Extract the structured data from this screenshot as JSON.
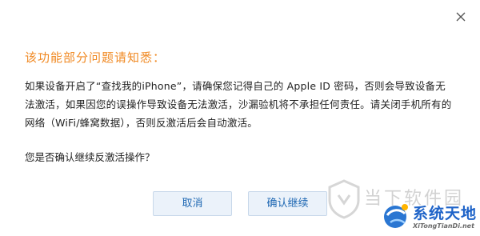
{
  "dialog": {
    "title": "该功能部分问题请知悉：",
    "message_lines": [
      "如果设备开启了“查找我的iPhone”，请确保您记得自己的 Apple ID 密码，否则会导致设备无",
      "法激活，如果因您的误操作导致设备无法激活，沙漏验机将不承担任何责任。请关闭手机所有的",
      "网络（WiFi/蜂窝数据），否则反激活后会自动激活。"
    ],
    "question": "您是否确认继续反激活操作？",
    "buttons": {
      "cancel": "取消",
      "confirm": "确认继续"
    },
    "close_icon": "close-icon"
  },
  "watermark": {
    "site_name": "当下软件园",
    "logo_text": "系统天地",
    "logo_url_text": "XiTongTianDi.net"
  },
  "colors": {
    "title": "#f08a24",
    "button_text": "#1f68b3",
    "button_bg": "#ebf2fa",
    "button_border": "#c8d8ea",
    "watermark_blue": "#1e63c8"
  }
}
